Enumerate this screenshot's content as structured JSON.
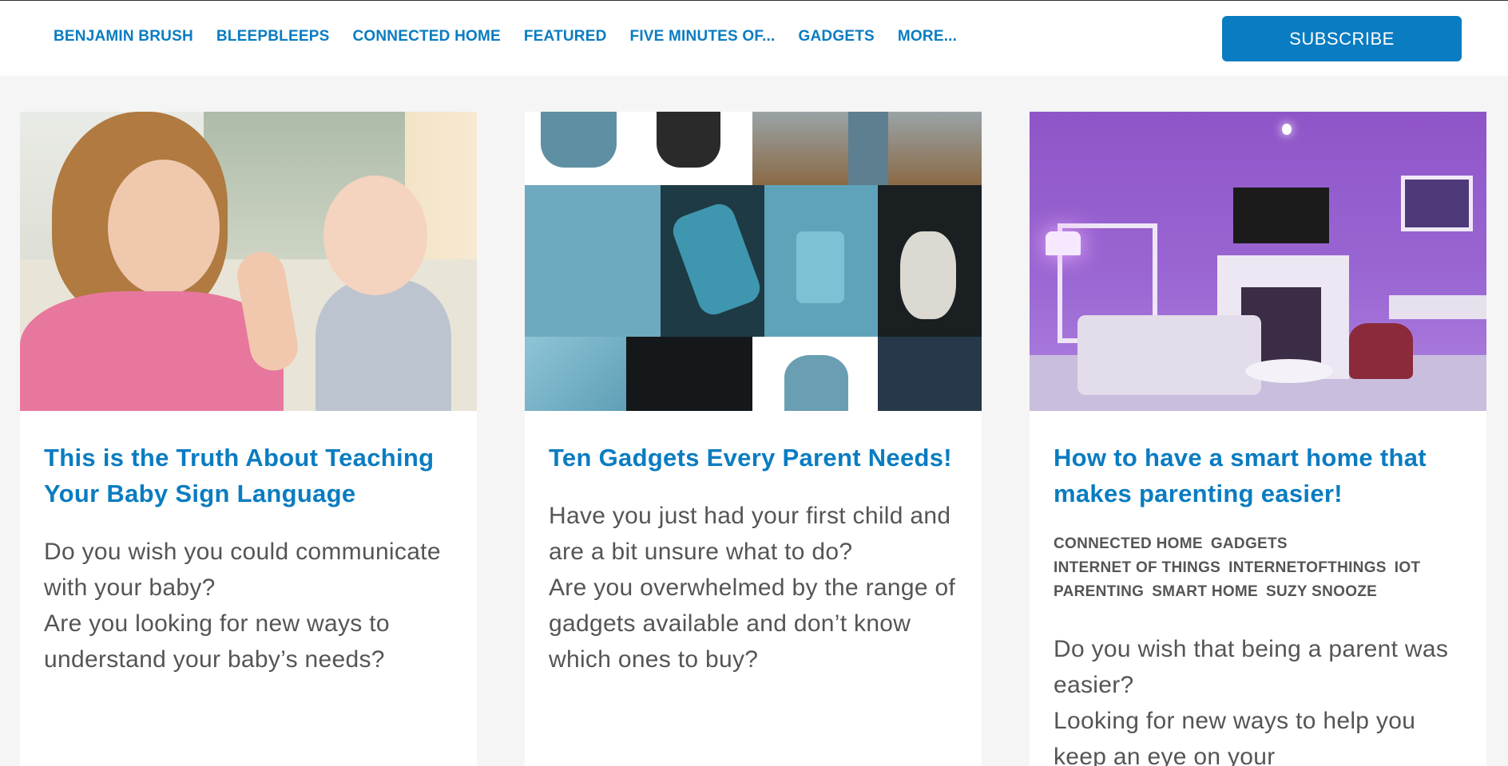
{
  "nav": {
    "items": [
      "BENJAMIN BRUSH",
      "BLEEPBLEEPS",
      "CONNECTED HOME",
      "FEATURED",
      "FIVE MINUTES OF...",
      "GADGETS",
      "MORE..."
    ],
    "subscribe_label": "SUBSCRIBE"
  },
  "colors": {
    "accent": "#0a7cc1",
    "body_text": "#555555",
    "background": "#f5f5f5"
  },
  "cards": [
    {
      "image_alt": "Mother signing to a baby",
      "title": "This is the Truth About Teaching Your Baby Sign Language",
      "excerpt": [
        "Do you wish you could communicate with your baby?",
        "Are you looking for new ways to understand your baby’s needs?"
      ],
      "tags": []
    },
    {
      "image_alt": "Collage of baby carrier details",
      "title": "Ten Gadgets Every Parent Needs!",
      "excerpt": [
        "Have you just had your first child and are a bit unsure what to do?",
        "Are you overwhelmed by the range of gadgets available and don’t know which ones to buy?"
      ],
      "tags": []
    },
    {
      "image_alt": "Smart home living room with purple lighting",
      "title": "How to have a smart home that makes parenting easier!",
      "tags": [
        "CONNECTED HOME",
        "GADGETS",
        "INTERNET OF THINGS",
        "INTERNETOFTHINGS",
        "IOT",
        "PARENTING",
        "SMART HOME",
        "SUZY SNOOZE"
      ],
      "excerpt": [
        "Do you wish that being a parent was easier?",
        "Looking for new ways to help you keep an eye on your"
      ]
    }
  ]
}
